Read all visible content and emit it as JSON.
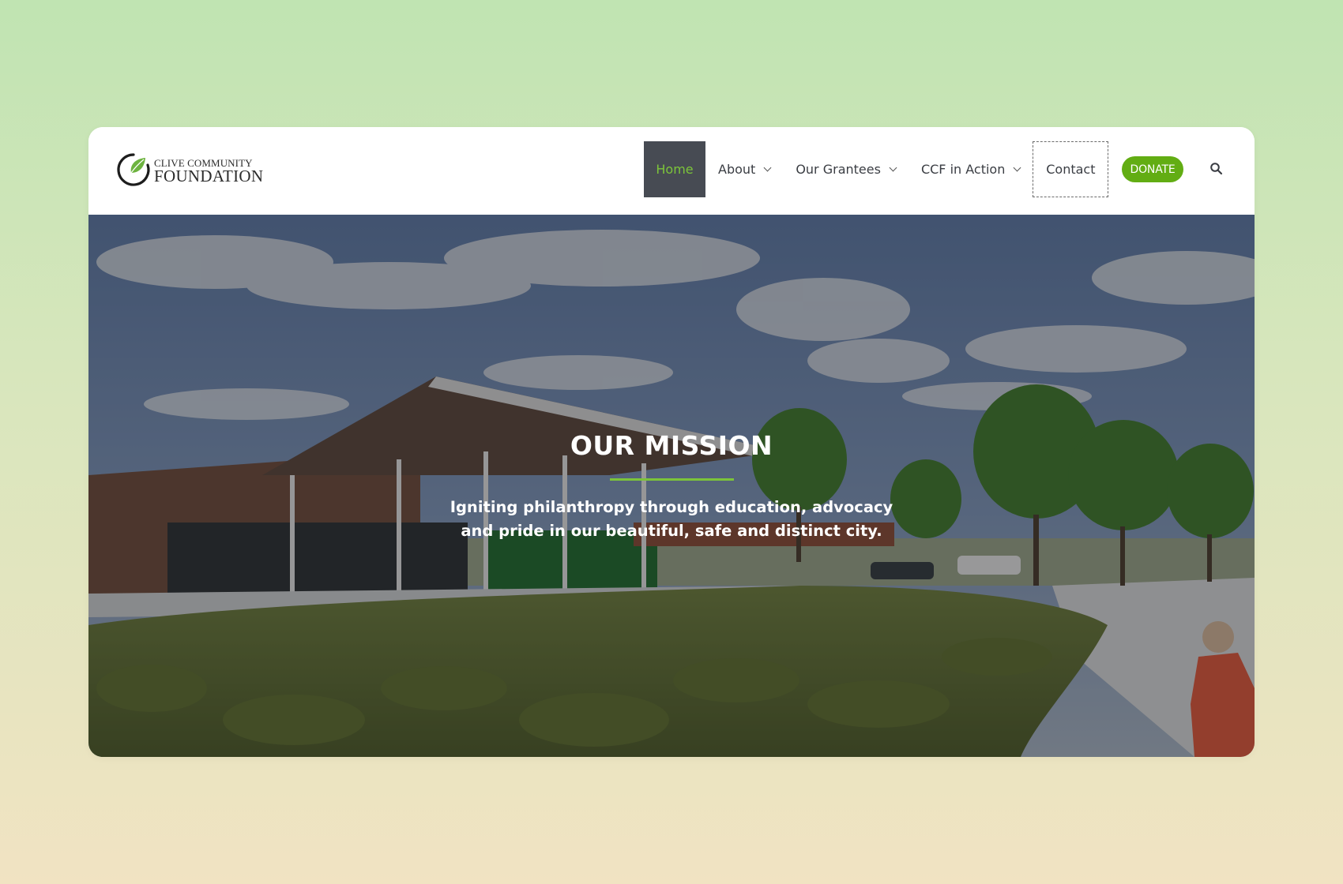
{
  "logo": {
    "line1": "Clive Community",
    "line2": "Foundation",
    "icon": "leaf-ring-icon"
  },
  "nav": {
    "items": [
      {
        "label": "Home",
        "active": true
      },
      {
        "label": "About",
        "dropdown": true
      },
      {
        "label": "Our Grantees",
        "dropdown": true
      },
      {
        "label": "CCF in Action",
        "dropdown": true
      },
      {
        "label": "Contact"
      }
    ],
    "donate_label": "DONATE",
    "search_icon": "search-icon"
  },
  "hero": {
    "title": "OUR MISSION",
    "text": "Igniting philanthropy through education, advocacy and pride in our beautiful, safe and distinct city."
  },
  "colors": {
    "accent": "#7cc43a",
    "donate": "#62ad13",
    "active_nav_bg": "#474b53"
  }
}
